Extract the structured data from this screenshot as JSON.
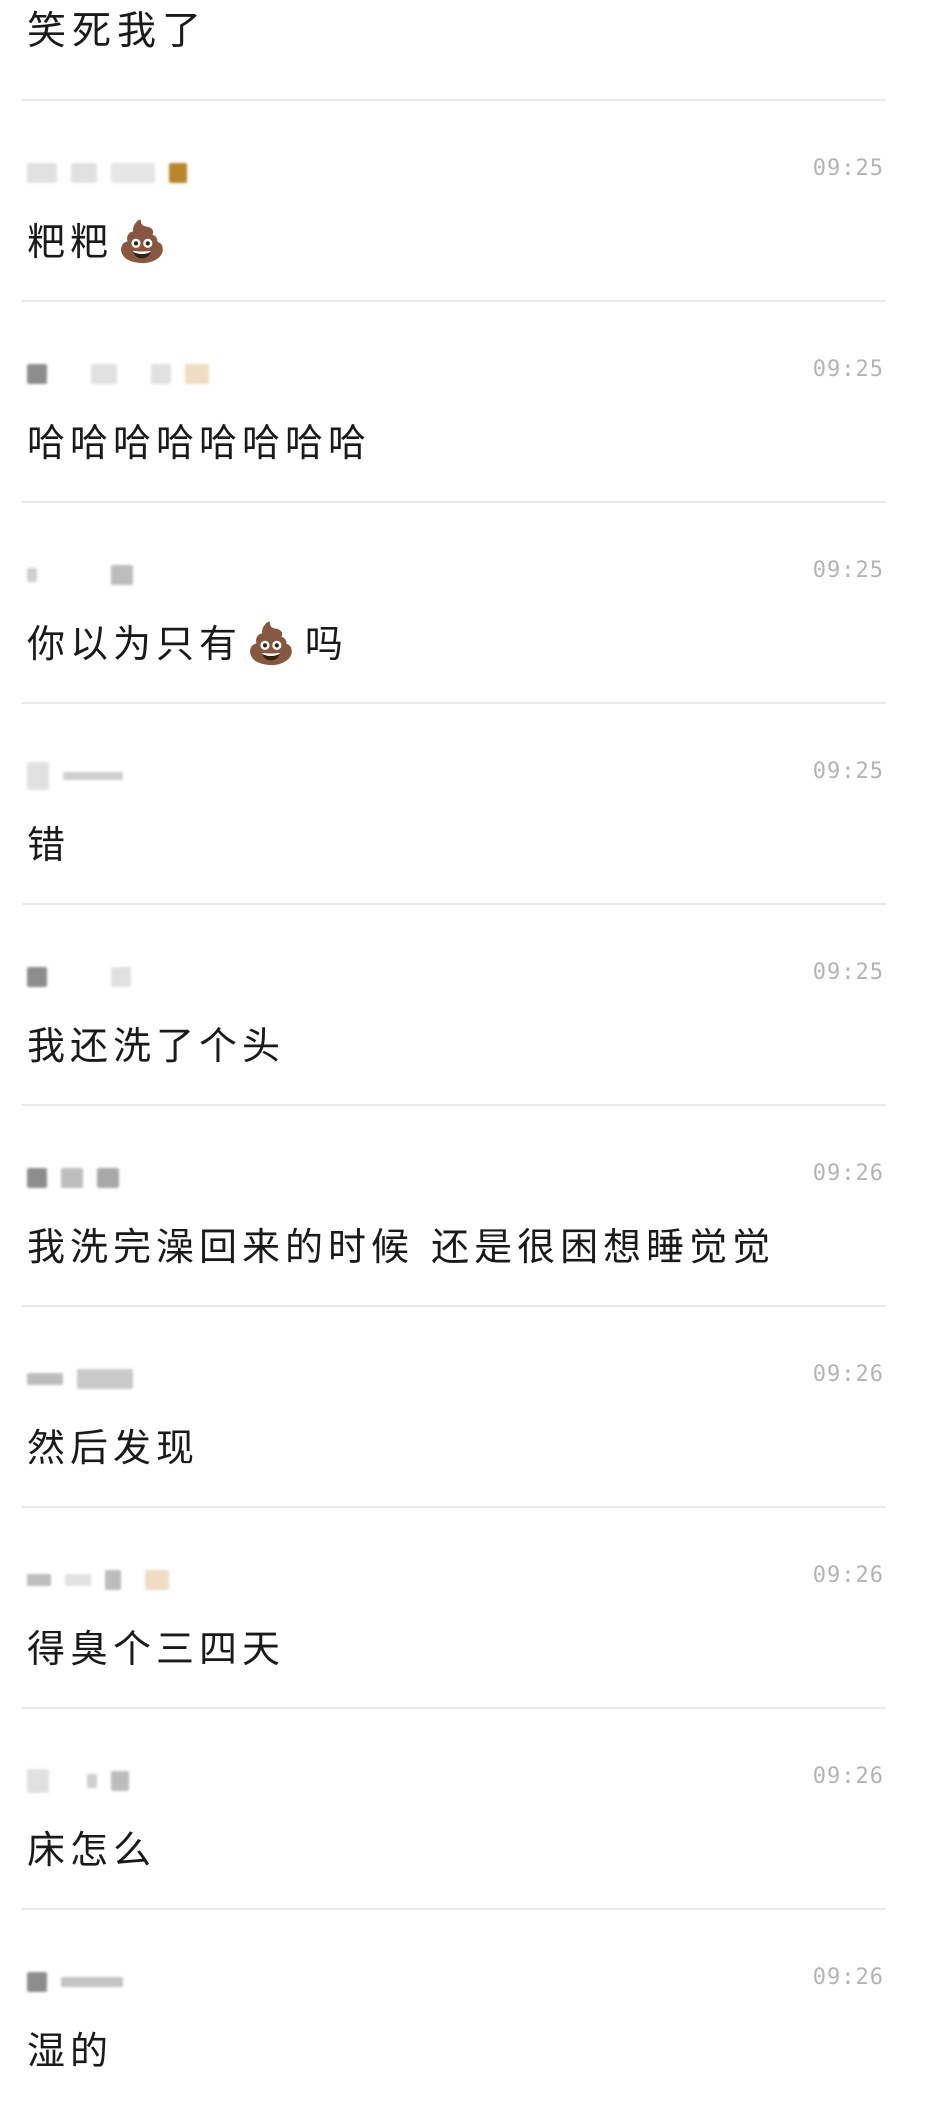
{
  "top_message": {
    "text": "笑死我了"
  },
  "messages": [
    {
      "time": "09:25",
      "parts": [
        "粑粑",
        "💩"
      ]
    },
    {
      "time": "09:25",
      "parts": [
        "哈哈哈哈哈哈哈哈"
      ]
    },
    {
      "time": "09:25",
      "parts": [
        "你以为只有",
        "💩",
        "吗"
      ]
    },
    {
      "time": "09:25",
      "parts": [
        "错"
      ]
    },
    {
      "time": "09:25",
      "parts": [
        "我还洗了个头"
      ]
    },
    {
      "time": "09:26",
      "parts": [
        "我洗完澡回来的时候 还是很困想睡觉觉"
      ]
    },
    {
      "time": "09:26",
      "parts": [
        "然后发现"
      ]
    },
    {
      "time": "09:26",
      "parts": [
        "得臭个三四天"
      ]
    },
    {
      "time": "09:26",
      "parts": [
        "床怎么"
      ]
    },
    {
      "time": "09:26",
      "parts": [
        "湿的"
      ]
    }
  ],
  "icons": {
    "emoji": "pile-of-poo-icon"
  }
}
